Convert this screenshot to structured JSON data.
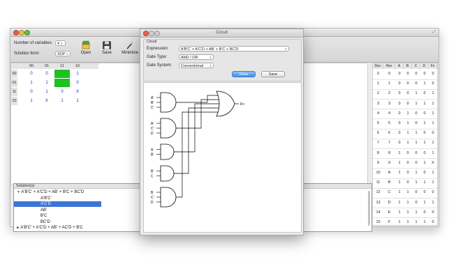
{
  "main": {
    "window_title": "",
    "variables_label": "Number of variables:",
    "variables_value": "4",
    "solution_form_label": "Solution form:",
    "solution_form_value": "SOP",
    "open_label": "Open",
    "save_label": "Save",
    "minimize_label": "Minimize"
  },
  "kmap": {
    "col_headers": [
      "00",
      "01",
      "11",
      "10"
    ],
    "row_headers": [
      "00",
      "01",
      "11",
      "10"
    ],
    "cells": [
      [
        "0",
        "0",
        "1",
        "1"
      ],
      [
        "1",
        "1",
        "1",
        "0"
      ],
      [
        "0",
        "1",
        "0",
        "X"
      ],
      [
        "1",
        "X",
        "1",
        "1"
      ]
    ],
    "highlight_color": "#1fc01f",
    "value_color": "#1030d0"
  },
  "solutions": {
    "header": "Solution(s)",
    "items": [
      {
        "text": "A'B'C' + A'C'D + AB' + B'C + BC'D",
        "level": 0,
        "toggle": "▼"
      },
      {
        "text": "A'B'C'",
        "level": 1
      },
      {
        "text": "A'C'D",
        "level": 1,
        "selected": true
      },
      {
        "text": "AB'",
        "level": 1
      },
      {
        "text": "B'C",
        "level": 1
      },
      {
        "text": "BC'D",
        "level": 1
      },
      {
        "text": "A'B'C' + A'C'D + AB' + AC'D + B'C",
        "level": 0,
        "toggle": "▶"
      }
    ]
  },
  "truth_table": {
    "headers": [
      "Dec",
      "Hex",
      "A",
      "B",
      "C",
      "D",
      "Fn"
    ],
    "rows": [
      [
        "0",
        "0",
        "0",
        "0",
        "0",
        "0",
        "0"
      ],
      [
        "1",
        "1",
        "0",
        "0",
        "0",
        "1",
        "0"
      ],
      [
        "2",
        "2",
        "0",
        "0",
        "1",
        "0",
        "1"
      ],
      [
        "3",
        "3",
        "0",
        "0",
        "1",
        "1",
        "1"
      ],
      [
        "4",
        "4",
        "0",
        "1",
        "0",
        "0",
        "1"
      ],
      [
        "5",
        "5",
        "0",
        "1",
        "0",
        "1",
        "1"
      ],
      [
        "6",
        "6",
        "0",
        "1",
        "1",
        "0",
        "0"
      ],
      [
        "7",
        "7",
        "0",
        "1",
        "1",
        "1",
        "1"
      ],
      [
        "8",
        "8",
        "1",
        "0",
        "0",
        "0",
        "1"
      ],
      [
        "9",
        "9",
        "1",
        "0",
        "0",
        "1",
        "X"
      ],
      [
        "10",
        "A",
        "1",
        "0",
        "1",
        "0",
        "1"
      ],
      [
        "11",
        "B",
        "1",
        "0",
        "1",
        "1",
        "1"
      ],
      [
        "12",
        "C",
        "1",
        "1",
        "0",
        "0",
        "0"
      ],
      [
        "13",
        "D",
        "1",
        "1",
        "0",
        "1",
        "1"
      ],
      [
        "14",
        "E",
        "1",
        "1",
        "1",
        "0",
        "X"
      ],
      [
        "15",
        "F",
        "1",
        "1",
        "1",
        "1",
        "0"
      ]
    ]
  },
  "circuit": {
    "window_title": "Circuit",
    "group_label": "Circuit",
    "expression_label": "Expression:",
    "expression_value": "A'B'C' + A'C'D + AB' + B'C + BC'D",
    "gate_type_label": "Gate Type:",
    "gate_type_value": "AND / OR",
    "gate_system_label": "Gate System:",
    "gate_system_value": "Conventional",
    "draw_label": "Draw",
    "save_label": "Save",
    "output_label": "Fn",
    "gates": [
      {
        "inputs": [
          "A'",
          "B'",
          "C'"
        ]
      },
      {
        "inputs": [
          "A'",
          "C'",
          "D"
        ]
      },
      {
        "inputs": [
          "A",
          "B'"
        ]
      },
      {
        "inputs": [
          "B'",
          "C"
        ]
      },
      {
        "inputs": [
          "B",
          "C'",
          "D"
        ]
      }
    ]
  }
}
